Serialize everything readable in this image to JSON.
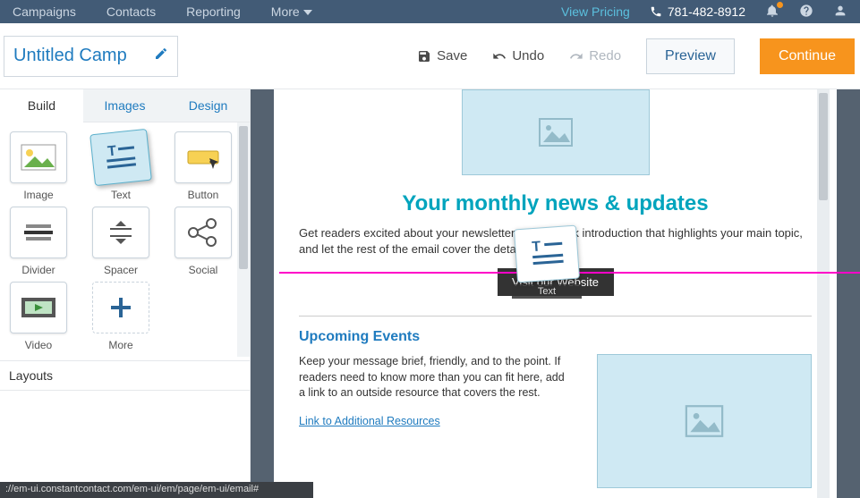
{
  "topnav": {
    "items": [
      "Campaigns",
      "Contacts",
      "Reporting"
    ],
    "more": "More",
    "pricing": "View Pricing",
    "phone": "781-482-8912"
  },
  "actionbar": {
    "title_value": "Untitled Camp",
    "save": "Save",
    "undo": "Undo",
    "redo": "Redo",
    "preview": "Preview",
    "continue": "Continue"
  },
  "sidebar": {
    "tabs": {
      "build": "Build",
      "images": "Images",
      "design": "Design"
    },
    "blocks": {
      "image": "Image",
      "text": "Text",
      "button": "Button",
      "divider": "Divider",
      "spacer": "Spacer",
      "social": "Social",
      "video": "Video",
      "more": "More"
    },
    "layouts_header": "Layouts"
  },
  "email": {
    "headline": "Your monthly news & updates",
    "intro": "Get readers excited about your newsletter with a quick introduction that highlights your main topic, and let the rest of the email cover the details.",
    "visit_btn": "Visit our Website",
    "upcoming_title": "Upcoming Events",
    "upcoming_body": "Keep your message brief, friendly, and to the point. If readers need to know more than you can fit here, add a link to an outside resource that covers the rest.",
    "link_text": "Link to Additional Resources"
  },
  "drag": {
    "label": "Text"
  },
  "status_url": "://em-ui.constantcontact.com/em-ui/em/page/em-ui/email#"
}
